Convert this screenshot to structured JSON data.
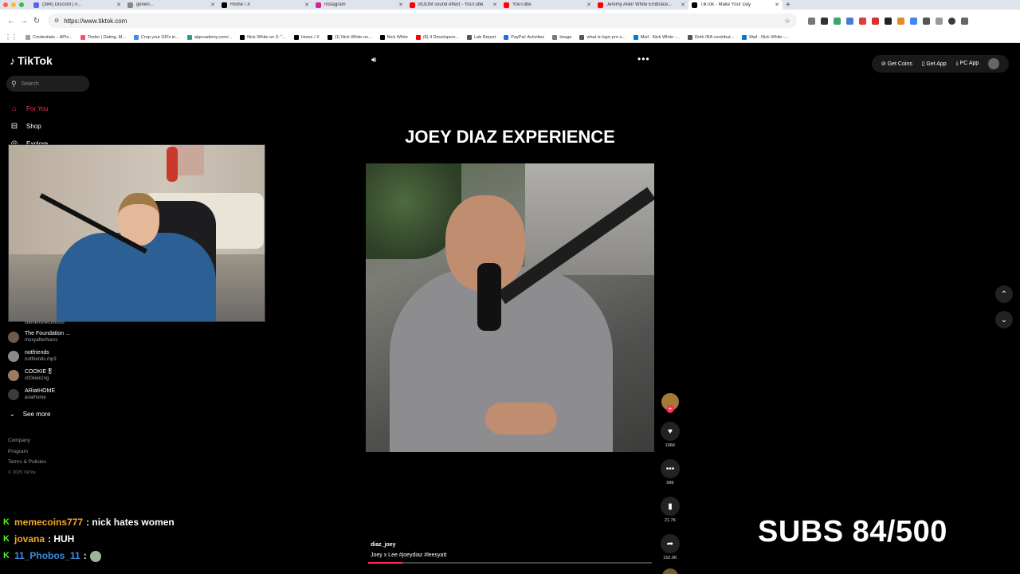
{
  "browser": {
    "tabs": [
      {
        "label": "(384) Discord | #...",
        "color": "#5865f2",
        "active": false
      },
      {
        "label": "generi...",
        "color": "#888888",
        "active": false
      },
      {
        "label": "Home / X",
        "color": "#000000",
        "active": false
      },
      {
        "label": "Instagram",
        "color": "#d6249f",
        "active": false
      },
      {
        "label": "BOOM sound effect - YouTube",
        "color": "#ff0000",
        "active": false
      },
      {
        "label": "YouTube",
        "color": "#ff0000",
        "active": false
      },
      {
        "label": "Jeremy Allen White Embrace...",
        "color": "#ff0000",
        "active": false
      },
      {
        "label": "TikTok - Make Your Day",
        "color": "#000000",
        "active": true
      }
    ],
    "url": "https://www.tiktok.com",
    "bookmarks": [
      "Credentials – APIs...",
      "Tinder | Dating, M...",
      "Crop your GIFs in...",
      "algocademy.com/...",
      "Nick White on X: \"...",
      "Home / X",
      "(1) Nick White on...",
      "Nick White",
      "(8) 4 Developers...",
      "Lab Report",
      "PayPal: Activities",
      "Image",
      "what is logic pro x...",
      "Mail - Nick White -...",
      "Roth IRA contribut...",
      "Mail - Nick White -..."
    ]
  },
  "tiktok": {
    "brand": "TikTok",
    "search_placeholder": "Search",
    "nav": [
      {
        "label": "For You",
        "icon": "home-icon",
        "active": true
      },
      {
        "label": "Shop",
        "icon": "shop-icon",
        "active": false
      },
      {
        "label": "Explore",
        "icon": "compass-icon",
        "active": false
      }
    ],
    "following_partial": "clementinetunesss",
    "following": [
      {
        "name": "The Foundation ...",
        "handle": "moxyafterhours"
      },
      {
        "name": "notfriends",
        "handle": "notfriends.mp3"
      },
      {
        "name": "COOKIE🎖",
        "handle": "c00kiek1ng"
      },
      {
        "name": "ARiatHOME",
        "handle": "ariathome"
      }
    ],
    "see_more": "See more",
    "footer": [
      "Company",
      "Program",
      "Terms & Policies"
    ],
    "copyright": "© 2025 TikTok",
    "top_actions": {
      "get_coins": "Get Coins",
      "get_app": "Get App",
      "pc_app": "PC App"
    },
    "video": {
      "title": "JOEY DIAZ EXPERIENCE",
      "author": "diaz_joey",
      "description": "Joey x Lee #joeydiaz  #leesyatt",
      "progress_pct": 12
    },
    "stats": {
      "likes": "196K",
      "comments": "996",
      "saves": "21.7K",
      "shares": "152.9K"
    }
  },
  "stream_overlay": {
    "chat": [
      {
        "user": "memecoins777",
        "user_color": "#f5a623",
        "text": ": nick hates women"
      },
      {
        "user": "jovana",
        "user_color": "#f5a623",
        "text": ": HUH"
      },
      {
        "user": "11_Phobos_11",
        "user_color": "#3a8de0",
        "text": ":"
      }
    ],
    "subs_label": "SUBS 84/500"
  }
}
